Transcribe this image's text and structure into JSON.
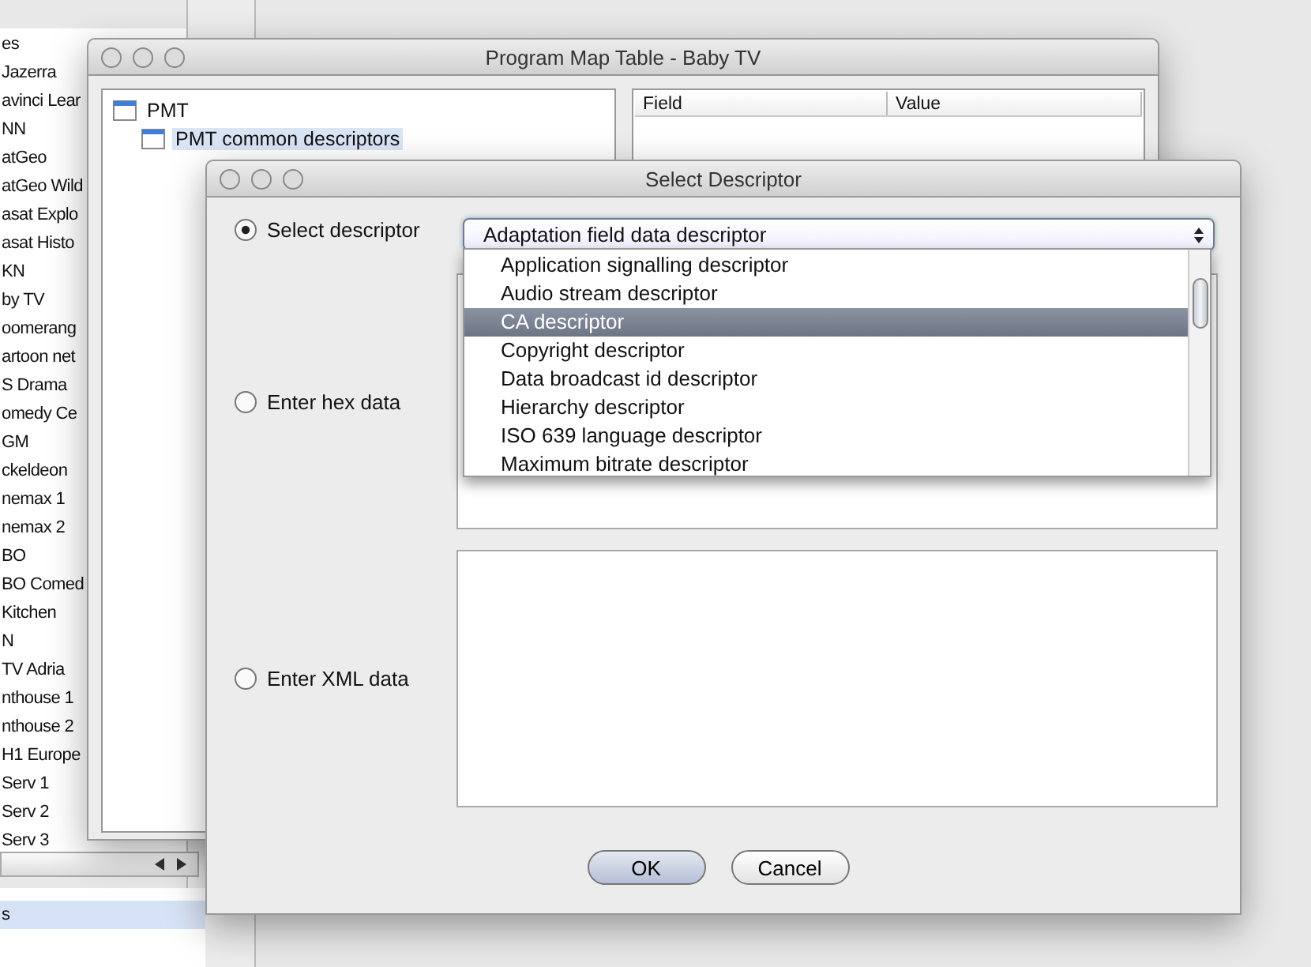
{
  "background_app": {
    "channel_list": [
      {
        "label": "es",
        "selected": false
      },
      {
        "label": "Jazerra",
        "selected": false
      },
      {
        "label": "avinci Lear",
        "selected": false
      },
      {
        "label": "NN",
        "selected": false
      },
      {
        "label": "atGeo",
        "selected": false
      },
      {
        "label": "atGeo Wild",
        "selected": false
      },
      {
        "label": "asat Explo",
        "selected": false
      },
      {
        "label": "asat Histo",
        "selected": false
      },
      {
        "label": "KN",
        "selected": false
      },
      {
        "label": "by TV",
        "selected": false
      },
      {
        "label": "oomerang",
        "selected": false
      },
      {
        "label": "artoon net",
        "selected": false
      },
      {
        "label": "S Drama",
        "selected": false
      },
      {
        "label": "omedy Ce",
        "selected": false
      },
      {
        "label": "GM",
        "selected": false
      },
      {
        "label": "ckeldeon",
        "selected": false
      },
      {
        "label": "nemax 1",
        "selected": false
      },
      {
        "label": "nemax 2",
        "selected": false
      },
      {
        "label": "BO",
        "selected": false
      },
      {
        "label": "BO Comed",
        "selected": false
      },
      {
        "label": "Kitchen",
        "selected": false
      },
      {
        "label": "N",
        "selected": false
      },
      {
        "label": "TV Adria",
        "selected": false
      },
      {
        "label": "nthouse 1",
        "selected": false
      },
      {
        "label": "nthouse 2",
        "selected": false
      },
      {
        "label": "H1 Europe",
        "selected": false
      },
      {
        "label": "Serv 1",
        "selected": false
      },
      {
        "label": "Serv 2",
        "selected": false
      },
      {
        "label": "Serv 3",
        "selected": false
      }
    ],
    "bottom_list": [
      {
        "label": "s",
        "selected": true
      }
    ]
  },
  "pmt_window": {
    "title": "Program Map Table - Baby TV",
    "tree": [
      {
        "label": "PMT",
        "selected": false,
        "children": [
          {
            "label": "PMT common descriptors",
            "selected": true
          }
        ]
      }
    ],
    "table": {
      "columns": [
        "Field",
        "Value"
      ]
    }
  },
  "dialog": {
    "title": "Select Descriptor",
    "options": [
      {
        "label": "Select descriptor",
        "selected": true,
        "kind": "combo"
      },
      {
        "label": "Enter hex data",
        "selected": false,
        "kind": "area"
      },
      {
        "label": "Enter XML data",
        "selected": false,
        "kind": "area"
      }
    ],
    "combo": {
      "value": "Adaptation field data descriptor",
      "open": true,
      "items": [
        {
          "label": "Application signalling descriptor",
          "selected": false
        },
        {
          "label": "Audio stream descriptor",
          "selected": false
        },
        {
          "label": "CA descriptor",
          "selected": true
        },
        {
          "label": "Copyright descriptor",
          "selected": false
        },
        {
          "label": "Data broadcast id descriptor",
          "selected": false
        },
        {
          "label": "Hierarchy descriptor",
          "selected": false
        },
        {
          "label": "ISO 639 language descriptor",
          "selected": false
        },
        {
          "label": "Maximum bitrate descriptor",
          "selected": false
        }
      ]
    },
    "buttons": [
      {
        "label": "OK",
        "default": true
      },
      {
        "label": "Cancel",
        "default": false
      }
    ]
  }
}
